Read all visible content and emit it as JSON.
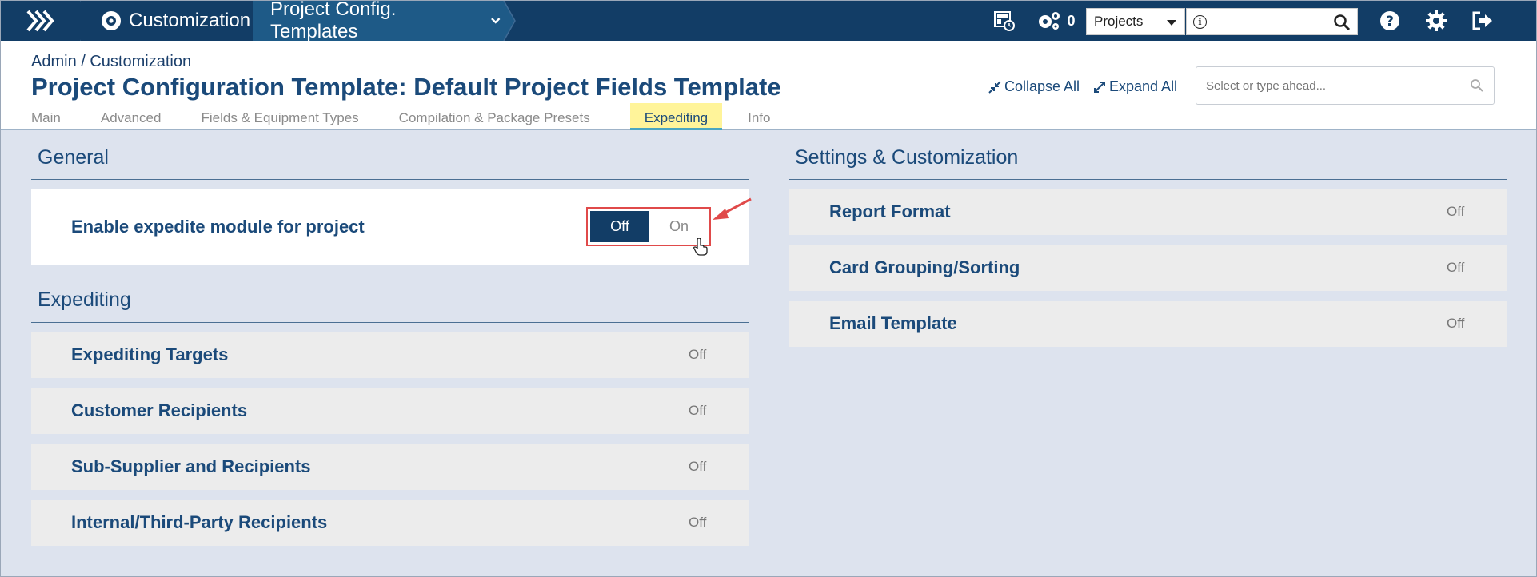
{
  "topbar": {
    "crumb_customization": "Customization",
    "crumb_templates": "Project Config. Templates",
    "settings_count": "0",
    "module_select": "Projects"
  },
  "header": {
    "breadcrumb": "Admin / Customization",
    "title": "Project Configuration Template: Default Project Fields Template",
    "collapse_all": "Collapse All",
    "expand_all": "Expand All",
    "search_placeholder": "Select or type ahead...",
    "tabs": [
      {
        "label": "Main"
      },
      {
        "label": "Advanced"
      },
      {
        "label": "Fields & Equipment Types"
      },
      {
        "label": "Compilation & Package Presets"
      },
      {
        "label": "Expediting"
      },
      {
        "label": "Info"
      }
    ]
  },
  "general": {
    "title": "General",
    "enable_label": "Enable expedite module for project",
    "toggle_off": "Off",
    "toggle_on": "On"
  },
  "expediting": {
    "title": "Expediting",
    "rows": [
      {
        "label": "Expediting Targets",
        "status": "Off"
      },
      {
        "label": "Customer Recipients",
        "status": "Off"
      },
      {
        "label": "Sub-Supplier and Recipients",
        "status": "Off"
      },
      {
        "label": "Internal/Third-Party Recipients",
        "status": "Off"
      }
    ]
  },
  "settings": {
    "title": "Settings & Customization",
    "rows": [
      {
        "label": "Report Format",
        "status": "Off"
      },
      {
        "label": "Card Grouping/Sorting",
        "status": "Off"
      },
      {
        "label": "Email Template",
        "status": "Off"
      }
    ]
  },
  "colors": {
    "navy": "#123d66",
    "accent_yellow": "#fff49a",
    "highlight_red": "#e04a4a"
  }
}
